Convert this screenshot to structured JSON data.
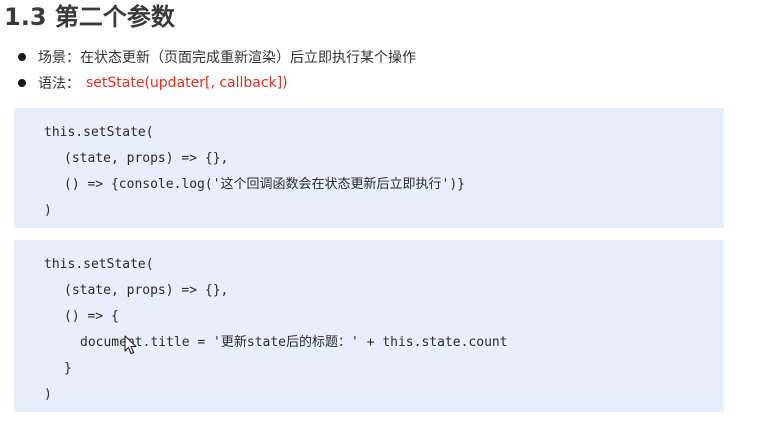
{
  "slide": {
    "title": "1.3 第二个参数",
    "bullets": [
      {
        "text": "场景：在状态更新（页面完成重新渲染）后立即执行某个操作"
      },
      {
        "label": "语法：",
        "code": "setState(updater[, callback])"
      }
    ],
    "code_blocks": [
      {
        "lines": [
          "this.setState(",
          "(state, props) => {},",
          "() => {console.log('这个回调函数会在状态更新后立即执行')}",
          ")"
        ]
      },
      {
        "lines": [
          "this.setState(",
          "(state, props) => {},",
          "() => {",
          "document.title = '更新state后的标题：' + this.state.count",
          "}",
          ")"
        ]
      }
    ]
  },
  "colors": {
    "code_bg": "#e8eefb",
    "syntax_red": "#e0301e",
    "title": "#3a3a3a"
  },
  "icons": {
    "cursor": "mouse-cursor-icon"
  }
}
